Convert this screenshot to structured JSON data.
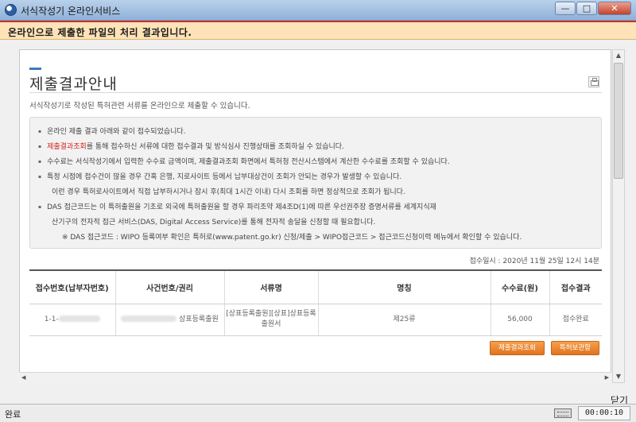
{
  "window": {
    "title": "서식작성기 온라인서비스",
    "minimize_label": "—",
    "maximize_label": "□",
    "close_label": "✕"
  },
  "banner": {
    "text": "온라인으로 제출한 파일의 처리 결과입니다."
  },
  "page": {
    "title": "제출결과안내",
    "subtitle": "서식작성기로 작성된 특허관련 서류를 온라인으로 제출할 수 있습니다."
  },
  "notice": {
    "line1": "온라인 제출 결과 아래와 같이 접수되었습니다.",
    "line2_link": "제출결과조회",
    "line2_rest": "를 통해 접수하신 서류에 대한 접수결과 및 방식심사 진행상태를 조회하실 수 있습니다.",
    "line3": "수수료는 서식작성기에서 입력한 수수료 금액이며, 제출결과조회 화면에서 특허청 전산시스템에서 계산한 수수료를 조회할 수 있습니다.",
    "line4": "특정 시점에 접수건이 많을 경우 간혹 은행, 지로사이트 등에서 납부대상건이 조회가 안되는 경우가 발생할 수 있습니다.",
    "line5": "이런 경우 특허로사이트에서 직접 납부하시거나 잠시 후(최대 1시간 이내) 다시 조회를 하면 정상적으로 조회가 됩니다.",
    "line6": "DAS 접근코드는 이 특허출원을 기초로 외국에 특허출원을 할 경우 파리조약 제4조D(1)에 따른 우선권주장 증명서류를 세계지식재",
    "line7": "산기구의 전자적 접근 서비스(DAS, Digital Access Service)를 통해 전자적 송달을 신청할 때 필요합니다.",
    "line8": "※ DAS 접근코드 : WIPO 등록여부 확인은 특허로(www.patent.go.kr) 신청/제출 > WIPO접근코드 > 접근코드신청이력 메뉴에서 확인할 수 있습니다."
  },
  "receipt": {
    "text": "접수일시 : 2020년 11월 25일 12시 14분"
  },
  "table": {
    "headers": [
      "접수번호(납부자번호)",
      "사건번호/권리",
      "서류명",
      "명칭",
      "수수료(원)",
      "접수결과"
    ],
    "row": {
      "receipt_no": "1-1-",
      "case_right": "상표등록출원",
      "doc_name": "[상표등록출원][상표]상표등록출원서",
      "title": "제25류",
      "fee": "56,000",
      "result": "접수완료"
    }
  },
  "buttons": {
    "result_lookup": "제출결과조회",
    "patent_storage": "특허보관함"
  },
  "close_button": "닫기",
  "status": {
    "text": "완료",
    "time": "00:00:10"
  }
}
